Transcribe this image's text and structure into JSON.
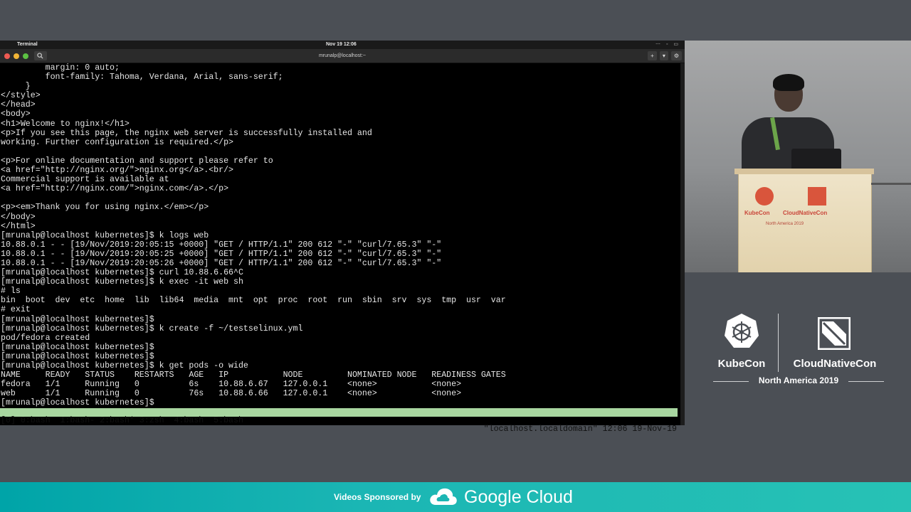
{
  "menubar": {
    "app_name": "Terminal",
    "clock": "Nov 19 12:06"
  },
  "window": {
    "title": "mrunalp@localhost:~",
    "new_tab_label": "+",
    "menu_label": "▾",
    "settings_label": "⚙"
  },
  "terminal": {
    "lines": [
      "         margin: 0 auto;",
      "         font-family: Tahoma, Verdana, Arial, sans-serif;",
      "     }",
      "</style>",
      "</head>",
      "<body>",
      "<h1>Welcome to nginx!</h1>",
      "<p>If you see this page, the nginx web server is successfully installed and",
      "working. Further configuration is required.</p>",
      "",
      "<p>For online documentation and support please refer to",
      "<a href=\"http://nginx.org/\">nginx.org</a>.<br/>",
      "Commercial support is available at",
      "<a href=\"http://nginx.com/\">nginx.com</a>.</p>",
      "",
      "<p><em>Thank you for using nginx.</em></p>",
      "</body>",
      "</html>",
      "[mrunalp@localhost kubernetes]$ k logs web",
      "10.88.0.1 - - [19/Nov/2019:20:05:15 +0000] \"GET / HTTP/1.1\" 200 612 \"-\" \"curl/7.65.3\" \"-\"",
      "10.88.0.1 - - [19/Nov/2019:20:05:25 +0000] \"GET / HTTP/1.1\" 200 612 \"-\" \"curl/7.65.3\" \"-\"",
      "10.88.0.1 - - [19/Nov/2019:20:05:26 +0000] \"GET / HTTP/1.1\" 200 612 \"-\" \"curl/7.65.3\" \"-\"",
      "[mrunalp@localhost kubernetes]$ curl 10.88.6.66^C",
      "[mrunalp@localhost kubernetes]$ k exec -it web sh",
      "# ls",
      "bin  boot  dev  etc  home  lib  lib64  media  mnt  opt  proc  root  run  sbin  srv  sys  tmp  usr  var",
      "# exit",
      "[mrunalp@localhost kubernetes]$",
      "[mrunalp@localhost kubernetes]$ k create -f ~/testselinux.yml",
      "pod/fedora created",
      "[mrunalp@localhost kubernetes]$",
      "[mrunalp@localhost kubernetes]$",
      "[mrunalp@localhost kubernetes]$ k get pods -o wide",
      "NAME     READY   STATUS    RESTARTS   AGE   IP           NODE         NOMINATED NODE   READINESS GATES",
      "fedora   1/1     Running   0          6s    10.88.6.67   127.0.0.1    <none>           <none>",
      "web      1/1     Running   0          76s   10.88.6.66   127.0.0.1    <none>           <none>",
      "[mrunalp@localhost kubernetes]$"
    ],
    "tmux_windows": "[0] 0:bash  1:bash- 2:bash* 3:zsh  4:bash  5:bash",
    "tmux_status": "\"localhost.localdomain\" 12:06 19-Nov-19"
  },
  "podium": {
    "kubecon": "KubeCon",
    "cncf": "CloudNativeCon",
    "region": "North America 2019"
  },
  "event": {
    "kubecon": "KubeCon",
    "cncf": "CloudNativeCon",
    "region": "North America 2019"
  },
  "footer": {
    "sponsored_by": "Videos Sponsored by",
    "sponsor": "Google Cloud"
  },
  "colors": {
    "terminal_bg": "#000000",
    "terminal_fg": "#e6e6e6",
    "tmux_status_bg": "#a8d6a0",
    "footer_teal": "#1bb6b4",
    "kubecon_red": "#c9463a"
  }
}
